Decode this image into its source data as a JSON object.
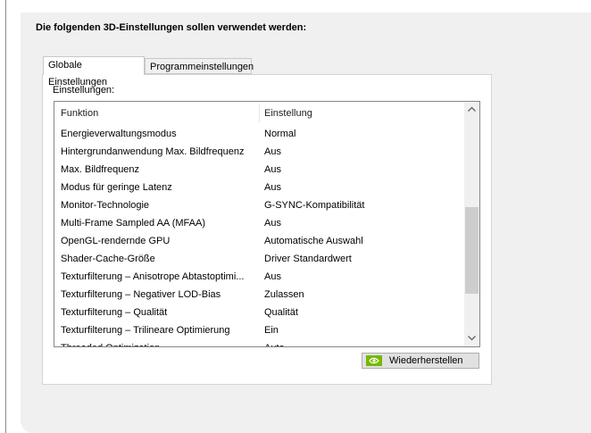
{
  "header": {
    "title": "Die folgenden 3D-Einstellungen sollen verwendet werden:"
  },
  "tabs": [
    {
      "label": "Globale Einstellungen",
      "active": true
    },
    {
      "label": "Programmeinstellungen",
      "active": false
    }
  ],
  "settings": {
    "label": "Einstellungen:",
    "columns": {
      "function": "Funktion",
      "setting": "Einstellung"
    },
    "rows": [
      {
        "function": "Energieverwaltungsmodus",
        "value": "Normal"
      },
      {
        "function": "Hintergrundanwendung Max. Bildfrequenz",
        "value": "Aus"
      },
      {
        "function": "Max. Bildfrequenz",
        "value": "Aus"
      },
      {
        "function": "Modus für geringe Latenz",
        "value": "Aus"
      },
      {
        "function": "Monitor-Technologie",
        "value": "G-SYNC-Kompatibilität"
      },
      {
        "function": "Multi-Frame Sampled AA (MFAA)",
        "value": "Aus"
      },
      {
        "function": "OpenGL-rendernde GPU",
        "value": "Automatische Auswahl"
      },
      {
        "function": "Shader-Cache-Größe",
        "value": "Driver Standardwert"
      },
      {
        "function": "Texturfilterung – Anisotrope Abtastoptimi...",
        "value": "Aus"
      },
      {
        "function": "Texturfilterung – Negativer LOD-Bias",
        "value": "Zulassen"
      },
      {
        "function": "Texturfilterung – Qualität",
        "value": "Qualität"
      },
      {
        "function": "Texturfilterung – Trilineare Optimierung",
        "value": "Ein"
      },
      {
        "function": "Threaded Optimization",
        "value": "Auto"
      }
    ]
  },
  "buttons": {
    "restore": "Wiederherstellen"
  },
  "icons": {
    "restore": "nvidia-logo-icon",
    "scroll_up": "chevron-up-icon",
    "scroll_down": "chevron-down-icon"
  },
  "colors": {
    "panel_background": "#f0f0f0",
    "nvidia_green": "#76b900",
    "scroll_thumb": "#cdcdcd"
  }
}
